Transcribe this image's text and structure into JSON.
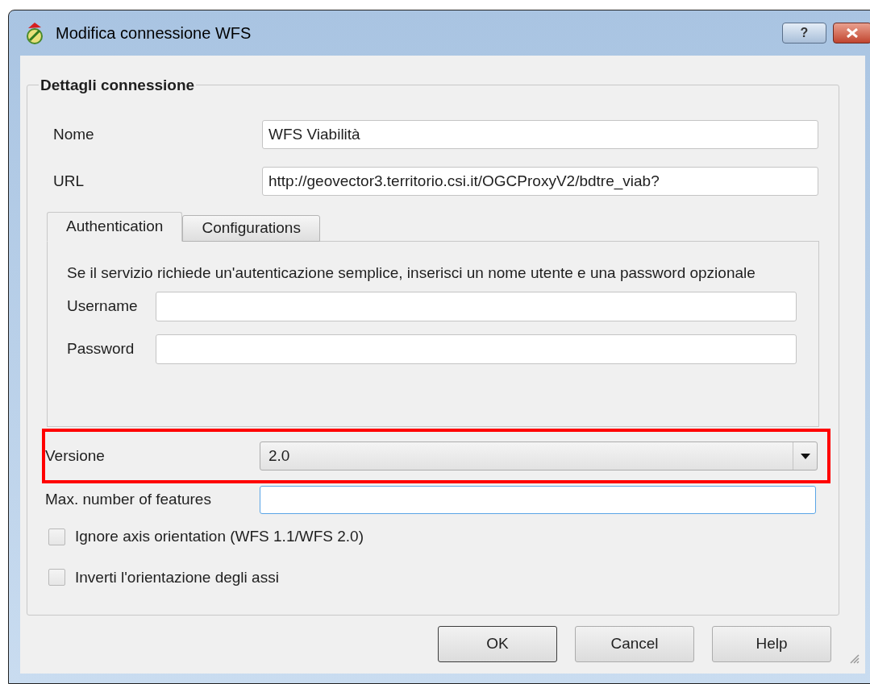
{
  "window": {
    "title": "Modifica connessione WFS",
    "help_button": "?"
  },
  "group": {
    "title": "Dettagli connessione",
    "fields": [
      {
        "label": "Nome",
        "value": "WFS Viabilità"
      },
      {
        "label": "URL",
        "value": "http://geovector3.territorio.csi.it/OGCProxyV2/bdtre_viab?"
      }
    ]
  },
  "tabs": [
    {
      "label": "Authentication",
      "selected": true
    },
    {
      "label": "Configurations",
      "selected": false
    }
  ],
  "authentication": {
    "description": "Se il servizio richiede un'autenticazione semplice, inserisci un nome utente e una password opzionale",
    "fields": [
      {
        "label": "Username"
      },
      {
        "label": "Password"
      }
    ]
  },
  "version": {
    "label": "Versione",
    "value": "2.0",
    "highlighted": true
  },
  "max_features": {
    "label": "Max. number of features",
    "focused": true
  },
  "checkboxes": [
    {
      "label": "Ignore axis orientation (WFS 1.1/WFS 2.0)",
      "checked": false
    },
    {
      "label": "Inverti l'orientazione degli assi",
      "checked": false
    }
  ],
  "buttons": [
    {
      "label": "OK",
      "default": true
    },
    {
      "label": "Cancel",
      "default": false
    },
    {
      "label": "Help",
      "default": false
    }
  ]
}
